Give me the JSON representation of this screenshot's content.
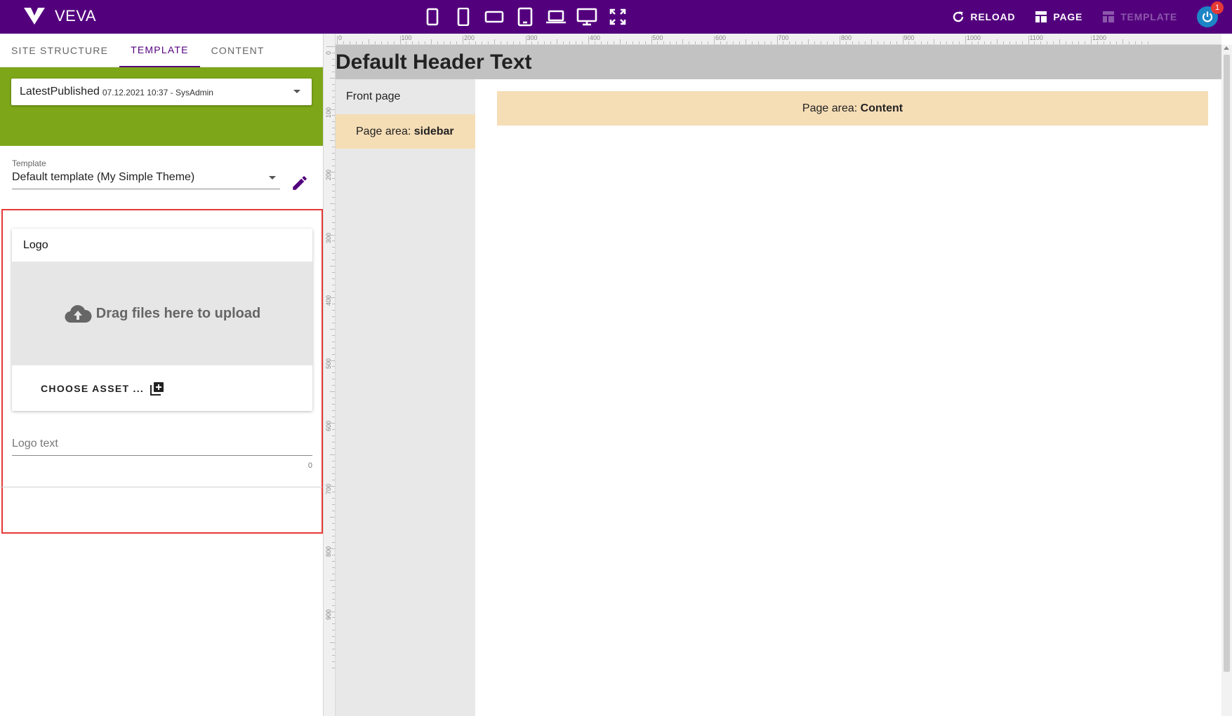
{
  "app": {
    "name": "VEVA",
    "device_icons": [
      "phone-portrait-icon",
      "phone-tall-icon",
      "phone-landscape-icon",
      "tablet-icon",
      "laptop-icon",
      "desktop-icon",
      "fullscreen-icon"
    ],
    "actions": {
      "reload": "RELOAD",
      "page": "PAGE",
      "template": "TEMPLATE"
    },
    "notification_count": "1",
    "brand_color": "#53007d"
  },
  "left_panel": {
    "tabs": [
      {
        "label": "SITE STRUCTURE"
      },
      {
        "label": "TEMPLATE"
      },
      {
        "label": "CONTENT"
      }
    ],
    "version": {
      "label": "LatestPublished",
      "meta": "07.12.2021 10:37 - SysAdmin"
    },
    "template_field": {
      "caption": "Template",
      "value": "Default template (My Simple Theme)"
    },
    "logo_card": {
      "title": "Logo",
      "drop_text": "Drag files here to upload",
      "choose_asset": "CHOOSE ASSET ..."
    },
    "logo_text": {
      "placeholder": "Logo text",
      "value": "",
      "count": "0"
    },
    "accent_green": "#7da719"
  },
  "rulers": {
    "horizontal": [
      "0",
      "100",
      "200",
      "300",
      "400",
      "500",
      "600",
      "700",
      "800",
      "900",
      "1000",
      "1100",
      "1200"
    ],
    "vertical": [
      "0",
      "100",
      "200",
      "300",
      "400",
      "500",
      "600",
      "700",
      "800",
      "900"
    ]
  },
  "preview": {
    "header": "Default Header Text",
    "front_page": "Front page",
    "sidebar_area": {
      "prefix": "Page area: ",
      "name": "sidebar"
    },
    "content_area": {
      "prefix": "Page area: ",
      "name": "Content"
    },
    "area_color": "#f5ddb6"
  }
}
